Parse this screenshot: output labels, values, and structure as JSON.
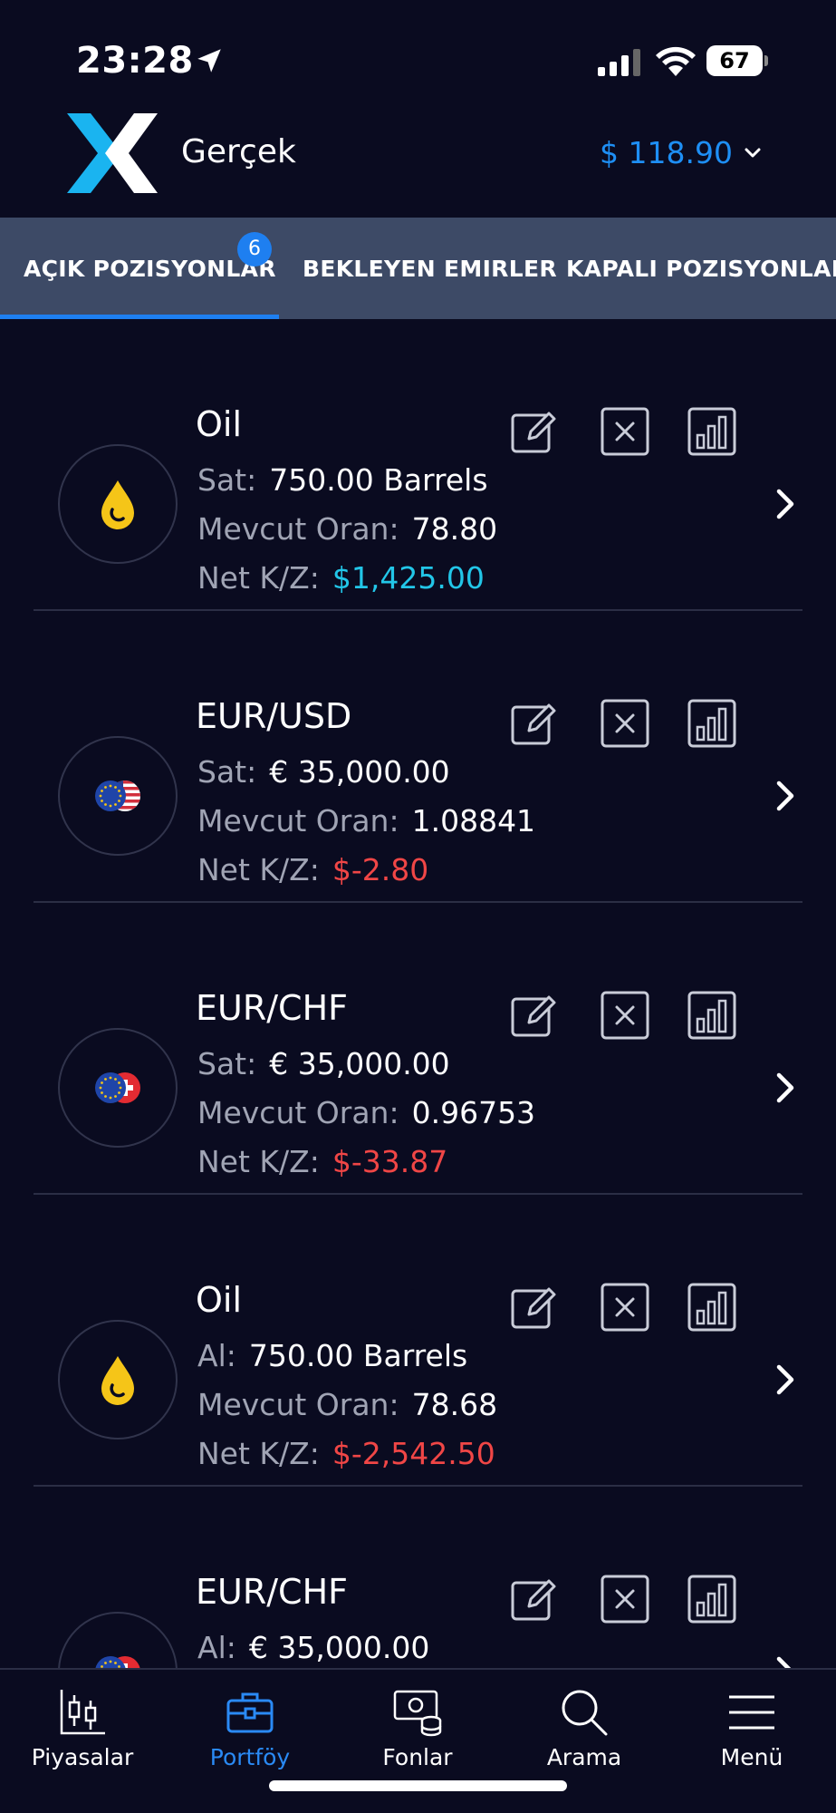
{
  "status_bar": {
    "time": "23:28",
    "battery": "67"
  },
  "header": {
    "account_type": "Gerçek",
    "balance": "$ 118.90"
  },
  "tabs": [
    {
      "label": "AÇIK POZISYONLAR",
      "badge": "6",
      "active": true
    },
    {
      "label": "BEKLEYEN EMIRLER",
      "active": false
    },
    {
      "label": "KAPALI POZISYONLAR",
      "active": false
    }
  ],
  "positions": [
    {
      "symbol": "Oil",
      "asset_icon": "oil-drop-icon",
      "side_label": "Sat:",
      "amount": "750.00 Barrels",
      "rate_label": "Mevcut Oran:",
      "rate": "78.80",
      "pl_label": "Net K/Z:",
      "pl": "$1,425.00",
      "pl_color": "#22c6e8"
    },
    {
      "symbol": "EUR/USD",
      "asset_icon": "eur-usd-flags-icon",
      "side_label": "Sat:",
      "amount": "€ 35,000.00",
      "rate_label": "Mevcut Oran:",
      "rate": "1.08841",
      "pl_label": "Net K/Z:",
      "pl": "$-2.80",
      "pl_color": "#f04646"
    },
    {
      "symbol": "EUR/CHF",
      "asset_icon": "eur-chf-flags-icon",
      "side_label": "Sat:",
      "amount": "€ 35,000.00",
      "rate_label": "Mevcut Oran:",
      "rate": "0.96753",
      "pl_label": "Net K/Z:",
      "pl": "$-33.87",
      "pl_color": "#f04646"
    },
    {
      "symbol": "Oil",
      "asset_icon": "oil-drop-icon",
      "side_label": "Al:",
      "amount": "750.00 Barrels",
      "rate_label": "Mevcut Oran:",
      "rate": "78.68",
      "pl_label": "Net K/Z:",
      "pl": "$-2,542.50",
      "pl_color": "#f04646"
    },
    {
      "symbol": "EUR/CHF",
      "asset_icon": "eur-chf-flags-icon",
      "side_label": "Al:",
      "amount": "€ 35,000.00"
    }
  ],
  "bottom_nav": [
    {
      "label": "Piyasalar",
      "icon": "candlestick-chart-icon",
      "active": false
    },
    {
      "label": "Portföy",
      "icon": "briefcase-icon",
      "active": true
    },
    {
      "label": "Fonlar",
      "icon": "money-coins-icon",
      "active": false
    },
    {
      "label": "Arama",
      "icon": "search-icon",
      "active": false
    },
    {
      "label": "Menü",
      "icon": "hamburger-menu-icon",
      "active": false
    }
  ],
  "colors": {
    "background": "#0a0b20",
    "tab_bar": "#3d4a66",
    "accent_blue": "#1e7ff0",
    "profit": "#22c6e8",
    "loss": "#f04646",
    "label_gray": "#a0a4b4"
  }
}
